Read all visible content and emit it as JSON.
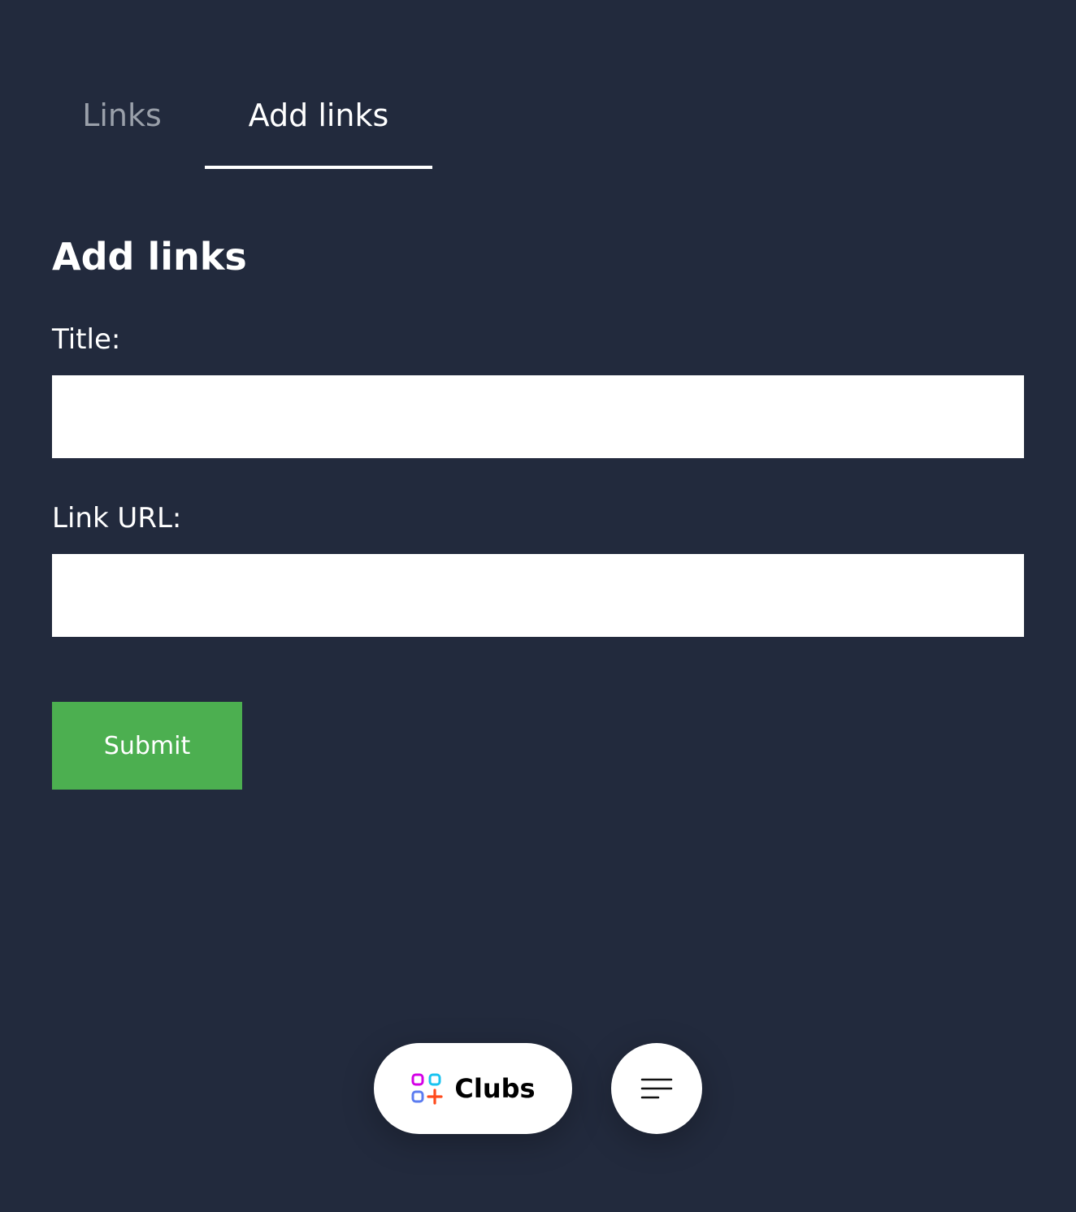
{
  "tabs": {
    "links_label": "Links",
    "add_links_label": "Add links",
    "active": "Add links"
  },
  "form": {
    "heading": "Add links",
    "title_label": "Title:",
    "title_value": "",
    "url_label": "Link URL:",
    "url_value": "",
    "submit_label": "Submit"
  },
  "bottom_nav": {
    "clubs_label": "Clubs",
    "clubs_icon": "clubs-grid-plus-icon",
    "menu_icon": "hamburger-menu-icon"
  },
  "colors": {
    "background": "#222a3d",
    "submit": "#4caf50",
    "tab_inactive": "#9aa0aa",
    "tab_active": "#ffffff",
    "icon_magenta": "#d400e6",
    "icon_cyan": "#19c3f0",
    "icon_blue": "#5b7cf0",
    "icon_orange": "#ff4a1c"
  }
}
